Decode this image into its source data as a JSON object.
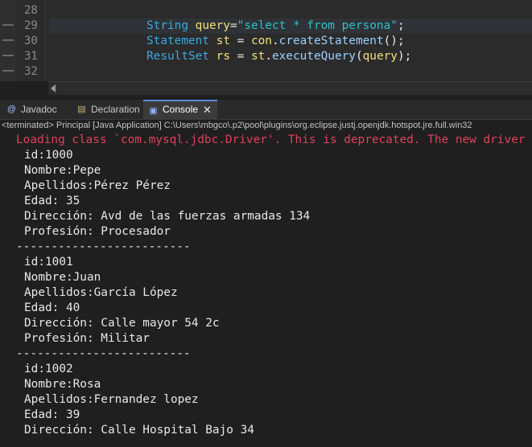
{
  "editor": {
    "line_numbers": [
      "28",
      "29",
      "30",
      "31",
      "32"
    ],
    "line29": {
      "type": "String",
      "var": "query",
      "eq": "=",
      "str": "\"select * from persona\"",
      "end": ";"
    },
    "line30": {
      "type": "Statement",
      "var": "st",
      "eq": " = ",
      "obj": "con",
      "dot": ".",
      "method": "createStatement",
      "end": "();"
    },
    "line31": {
      "type": "ResultSet",
      "var": "rs",
      "eq": " = ",
      "obj": "st",
      "dot": ".",
      "method": "executeQuery",
      "open": "(",
      "arg": "query",
      "end": ");"
    }
  },
  "tabs": {
    "javadoc": "Javadoc",
    "declaration": "Declaration",
    "console": "Console",
    "close_glyph": "✕"
  },
  "status_line": "<terminated> Principal [Java Application] C:\\Users\\mbgco\\.p2\\pool\\plugins\\org.eclipse.justj.openjdk.hotspot.jre.full.win32",
  "console": {
    "warning": "Loading class `com.mysql.jdbc.Driver'. This is deprecated. The new driver class is",
    "lines": [
      "id:1000",
      "Nombre:Pepe",
      "Apellidos:Pérez Pérez",
      "Edad: 35",
      "Dirección: Avd de las fuerzas armadas 134",
      "Profesión: Procesador",
      "-------------------------",
      "id:1001",
      "Nombre:Juan",
      "Apellidos:García López",
      "Edad: 40",
      "Dirección: Calle mayor 54 2c",
      "Profesión: Militar",
      "-------------------------",
      "id:1002",
      "Nombre:Rosa",
      "Apellidos:Fernandez lopez",
      "Edad: 39",
      "Dirección: Calle Hospital Bajo 34"
    ]
  },
  "colors": {
    "warning": "#e0405b",
    "type": "#3ba9e0",
    "variable": "#f2e07b",
    "string": "#2fc1cb",
    "active_tab_accent": "#5a8ad9"
  }
}
